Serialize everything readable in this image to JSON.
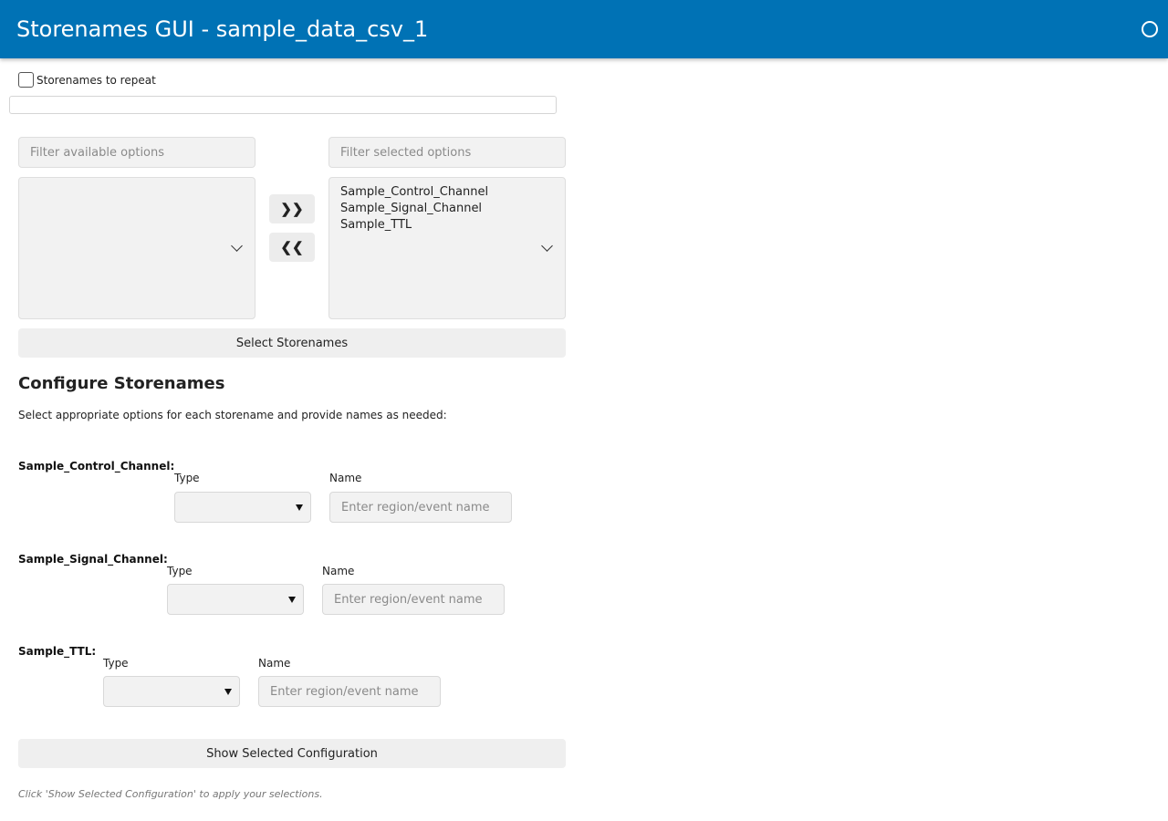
{
  "header": {
    "title": "Storenames GUI - sample_data_csv_1"
  },
  "repeat": {
    "label": "Storenames to repeat",
    "checked": false
  },
  "selector": {
    "available_filter_placeholder": "Filter available options",
    "selected_filter_placeholder": "Filter selected options",
    "available_items": [],
    "selected_items": [
      "Sample_Control_Channel",
      "Sample_Signal_Channel",
      "Sample_TTL"
    ],
    "move_right_label": "❯❯",
    "move_left_label": "❮❮",
    "select_button": "Select Storenames"
  },
  "configure": {
    "title": "Configure Storenames",
    "description": "Select appropriate options for each storename and provide names as needed:",
    "type_label": "Type",
    "name_label": "Name",
    "name_placeholder": "Enter region/event name",
    "rows": [
      {
        "storename": "Sample_Control_Channel:",
        "type_value": "",
        "name_value": ""
      },
      {
        "storename": "Sample_Signal_Channel:",
        "type_value": "",
        "name_value": ""
      },
      {
        "storename": "Sample_TTL:",
        "type_value": "",
        "name_value": ""
      }
    ]
  },
  "show_button": "Show Selected Configuration",
  "footer_note": "Click 'Show Selected Configuration' to apply your selections."
}
